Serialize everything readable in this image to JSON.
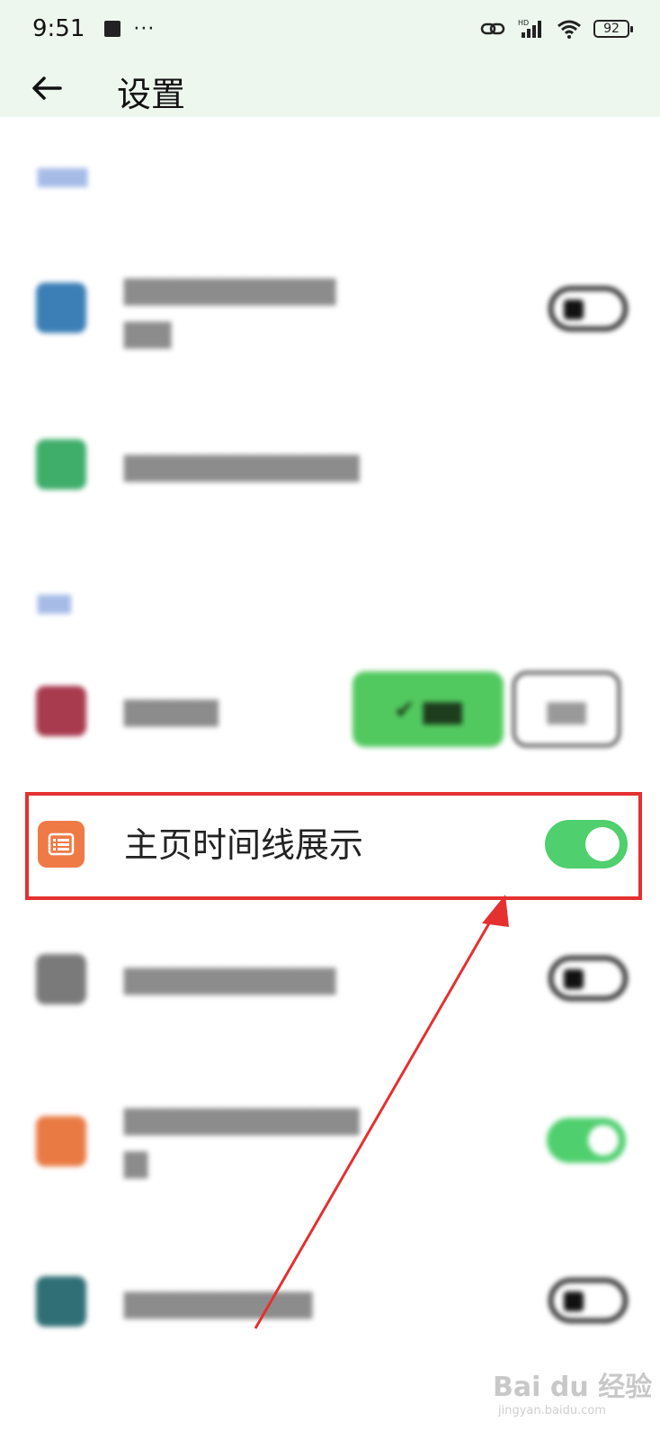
{
  "status_bar": {
    "time": "9:51",
    "dots": "···",
    "battery": "92",
    "icons": [
      "link-icon",
      "signal-icon",
      "wifi-icon"
    ]
  },
  "header": {
    "title": "设置",
    "back_icon": "arrow-left-icon"
  },
  "blurred_rows": [
    {
      "icon_color": "#3b7fb6"
    },
    {
      "icon_color": "#3fae6a"
    },
    {
      "icon_color": "#a83b4e"
    },
    {
      "icon_color": "#7a7a7a"
    },
    {
      "icon_color": "#ea7a44"
    },
    {
      "icon_color": "#2f6f75"
    }
  ],
  "highlighted_row": {
    "label": "主页时间线展示",
    "icon": "list-icon",
    "icon_color": "#ef7a45",
    "toggle_on": true
  },
  "colors": {
    "accent_green": "#4fcf6e",
    "highlight_red": "#e53030",
    "header_bg": "#eef7ee"
  },
  "watermark": {
    "brand": "Bai du 经验",
    "site": "jingyan.baidu.com"
  }
}
